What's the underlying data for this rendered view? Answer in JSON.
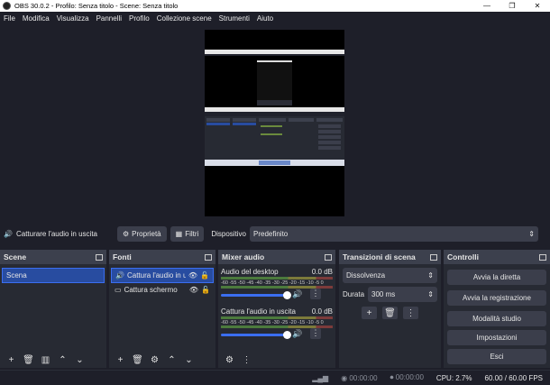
{
  "window": {
    "title": "OBS 30.0.2 - Profilo: Senza titolo - Scene: Senza titolo",
    "controls": [
      "—",
      "❐",
      "✕"
    ]
  },
  "menu": [
    "File",
    "Modifica",
    "Visualizza",
    "Pannelli",
    "Profilo",
    "Collezione scene",
    "Strumenti",
    "Aiuto"
  ],
  "source_bar": {
    "selected_source": "Catturare l'audio in uscita",
    "properties_label": "Proprietà",
    "filters_label": "Filtri",
    "device_label": "Dispositivo",
    "device_value": "Predefinito"
  },
  "scenes": {
    "title": "Scene",
    "items": [
      "Scena"
    ]
  },
  "sources": {
    "title": "Fonti",
    "items": [
      "Cattura l'audio in uscita",
      "Cattura schermo"
    ]
  },
  "mixer": {
    "title": "Mixer audio",
    "scale": "-60 -55 -50 -45 -40 -35 -30 -25 -20 -15 -10 -5 0",
    "tracks": [
      {
        "name": "Audio del desktop",
        "db": "0.0 dB"
      },
      {
        "name": "Cattura l'audio in uscita",
        "db": "0.0 dB"
      }
    ]
  },
  "transitions": {
    "title": "Transizioni di scena",
    "selected": "Dissolvenza",
    "duration_label": "Durata",
    "duration_value": "300 ms"
  },
  "controls": {
    "title": "Controlli",
    "buttons": [
      "Avvia la diretta",
      "Avvia la registrazione",
      "Modalità studio",
      "Impostazioni",
      "Esci"
    ]
  },
  "status": {
    "stream_time": "00:00:00",
    "rec_time": "00:00:00",
    "cpu": "CPU: 2.7%",
    "fps": "60.00 / 60.00 FPS"
  }
}
